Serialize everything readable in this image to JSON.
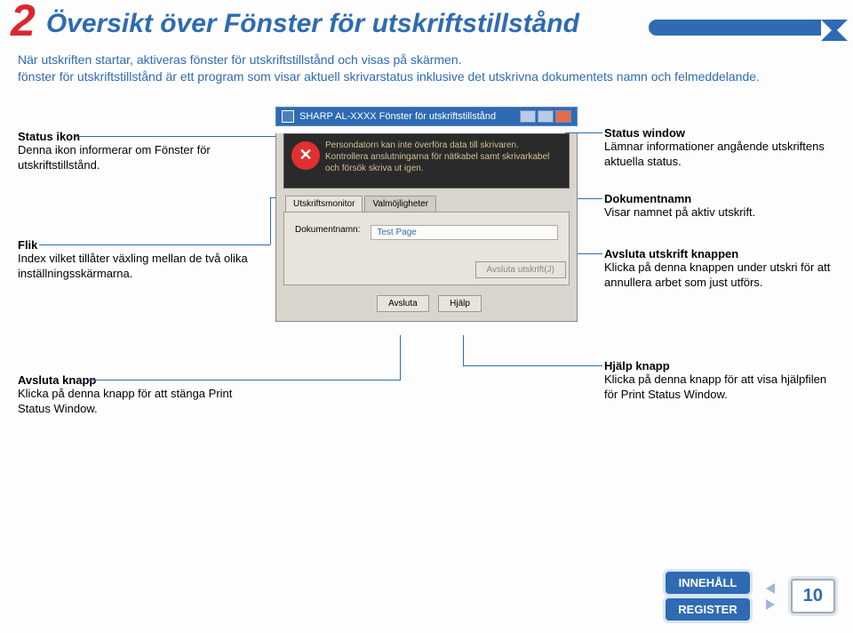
{
  "chapter": {
    "number": "2",
    "title": "Översikt över Fönster för utskriftstillstånd"
  },
  "intro": {
    "line1": "När utskriften startar, aktiveras fönster för utskriftstillstånd och visas på skärmen.",
    "line2": "fönster för utskriftstillstånd är ett program som visar aktuell skrivarstatus inklusive det utskrivna dokumentets namn och felmeddelande."
  },
  "window": {
    "title": "SHARP AL-XXXX Fönster för utskriftstillstånd",
    "status_text": "Persondatorn kan inte överföra data till skrivaren. Kontrollera anslutningarna för nätkabel samt skrivarkabel och försök skriva ut igen.",
    "tab1": "Utskriftsmonitor",
    "tab2": "Valmöjligheter",
    "doc_label": "Dokumentnamn:",
    "doc_value": "Test Page",
    "cancel_print": "Avsluta utskrift(J)",
    "close": "Avsluta",
    "help": "Hjälp"
  },
  "callouts": {
    "status_icon": {
      "title": "Status ikon",
      "body": "Denna ikon informerar om Fönster för utskriftstillstånd."
    },
    "flik": {
      "title": "Flik",
      "body": "Index vilket tillåter växling mellan de två olika inställningsskärmarna."
    },
    "avsluta": {
      "title": "Avsluta knapp",
      "body": "Klicka på denna knapp för att stänga Print Status Window."
    },
    "status_win": {
      "title": "Status window",
      "body": "Lämnar informationer angående utskriftens aktuella status."
    },
    "docname": {
      "title": "Dokumentnamn",
      "body": "Visar namnet på aktiv utskrift."
    },
    "cancel": {
      "title": "Avsluta utskrift knappen",
      "body": "Klicka på denna knappen under utskri för att annullera arbet som just utförs."
    },
    "hjalp": {
      "title": "Hjälp knapp",
      "body": "Klicka på denna knapp för att visa hjälpfilen för Print Status Window."
    }
  },
  "footer": {
    "contents": "INNEHÅLL",
    "register": "REGISTER",
    "page": "10"
  }
}
